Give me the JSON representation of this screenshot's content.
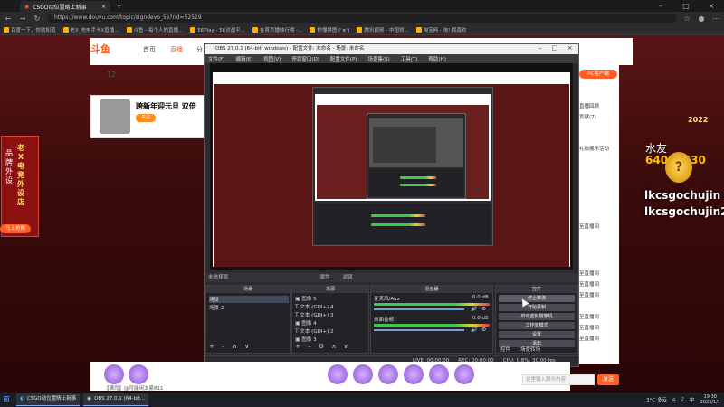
{
  "browser": {
    "tabs": [
      {
        "label": "CSGO动位置睛上新事",
        "active": true
      },
      {
        "label": "CSGO动位置睛上新事",
        "active": false
      }
    ],
    "url": "https://www.douyu.com/topic/signdevo_5e?rid=52519",
    "bookmarks": [
      "百度一下，你就知道",
      "老X_充电手卡X直播...",
      "斗鱼 - 每个人的直播...",
      "5EPlay - 5E对战平...",
      "在首页播映行榜 -...",
      "秒懂拼图 (ᵔᴥᵔ)",
      "腾讯视频 - 中国领...",
      "淘宝网 - 淘! 我喜欢"
    ]
  },
  "douyu": {
    "logo": "斗鱼",
    "nav": [
      "首页",
      "直播",
      "分"
    ],
    "active_nav": "直播",
    "stat_count": "12",
    "stream_title": "跨新年迎元旦 双倍",
    "follow": "关注",
    "pc_button": "PC客户端",
    "chat_lines": [
      "直播回顾",
      "贡献(7)",
      "礼物展示活动",
      "至直播间",
      "至直播间",
      "至直播间",
      "至直播间",
      "至直播间",
      "至直播间",
      "至直播间"
    ],
    "overlay_text": "水友",
    "overlay_number": "64040630",
    "overlay_name_1": "lkcsgochujin",
    "overlay_name_2": "lkcsgochujin2",
    "medal_year": "2022",
    "left_banner_vertical": "老X电竞外设店",
    "left_banner_side": "品牌外设",
    "buy_button": "马上抢购",
    "chat_placeholder": "这里输入聊天内容",
    "send_label": "发送",
    "user_bar": "【满司】@可能闲太紧811"
  },
  "obs": {
    "title": "OBS 27.0.1 (64-bit, windows) - 配置文件: 未命名 - 场景: 未命名",
    "menu": [
      "文件(F)",
      "编辑(E)",
      "视图(V)",
      "停靠窗口(D)",
      "配置文件(P)",
      "场景集(S)",
      "工具(T)",
      "帮助(H)"
    ],
    "scene_label": "未选择源",
    "filter_buttons": [
      "属性",
      "滤镜"
    ],
    "docks": {
      "scenes_title": "场景",
      "sources_title": "来源",
      "mixer_title": "混音器",
      "controls_title": "控件"
    },
    "scenes": [
      "场景",
      "场景 2"
    ],
    "sources": [
      "图像 5",
      "文本 (GDI+) 4",
      "文本 (GDI+) 3",
      "图像 4",
      "文本 (GDI+) 2",
      "图像 3"
    ],
    "mixer": [
      {
        "name": "麦克风/Aux",
        "db": "0.0 dB"
      },
      {
        "name": "桌面音频",
        "db": "0.0 dB"
      }
    ],
    "controls": [
      "停止推流",
      "开始录制",
      "启动虚拟摄像机",
      "工作室模式",
      "设置",
      "退出"
    ],
    "control_tabs": [
      "控件",
      "场景转场"
    ],
    "status": [
      "LIVE: 00:00:00",
      "REC: 00:00:00",
      "CPU: 0.8%, 30.00 fps"
    ]
  },
  "taskbar": {
    "items": [
      "CSGO动位置睛上新事",
      "OBS 27.0.1 (64-bit..."
    ],
    "weather": "3°C 多云",
    "time": "19:30",
    "date": "2023/1/1",
    "lang": "中"
  }
}
